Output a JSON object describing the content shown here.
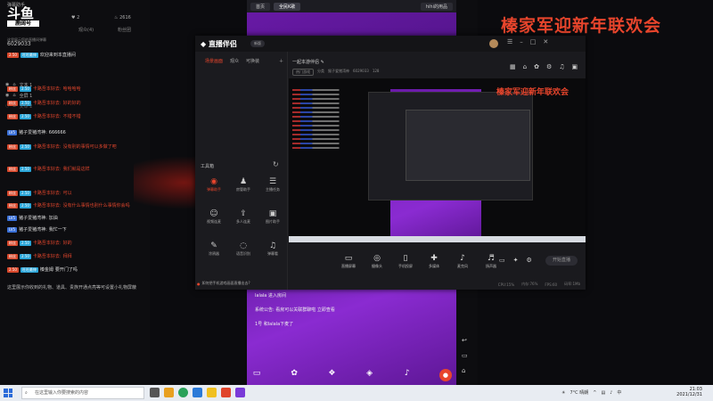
{
  "chat": {
    "logo_main": "斗鱼",
    "logo_sub": "鹿阔号",
    "title": "弹幕助手",
    "stat_fans": "2",
    "stat_hot": "2616",
    "tabs": [
      "观众(4)",
      "粉丝团"
    ],
    "room_id": "6029033",
    "notice_line": "这里展示您的直播间弹幕",
    "messages": [
      {
        "badges": [
          "2.50",
          "旺旺最伸"
        ],
        "user": "",
        "text": "欢迎来到本直播间",
        "color": "white"
      },
      {
        "badges": [
          "粉丝",
          "2.50"
        ],
        "user": "卡路吾本好去:",
        "text": "哈哈哈哈",
        "color": "red"
      },
      {
        "badges": [
          "粉丝",
          "2.50"
        ],
        "user": "卡路吾本好去:",
        "text": "好的好的",
        "color": "red"
      },
      {
        "badges": [
          "粉丝",
          "2.50"
        ],
        "user": "卡路吾本好去:",
        "text": "不错不错",
        "color": "red"
      },
      {
        "badges": [
          "LV5"
        ],
        "user": "猪子爱猪湾神:",
        "text": "666666",
        "color": "white"
      },
      {
        "badges": [
          "粉丝",
          "2.50"
        ],
        "user": "卡路吾本好去:",
        "text": "没有别的事情可以多做了吧",
        "color": "red"
      },
      {
        "badges": [
          "粉丝",
          "2.50"
        ],
        "user": "卡路吾本好去:",
        "text": "我们就是这样",
        "color": "red"
      },
      {
        "badges": [
          "粉丝",
          "2.50"
        ],
        "user": "卡路吾本好去:",
        "text": "可以",
        "color": "red"
      },
      {
        "badges": [
          "粉丝",
          "2.50"
        ],
        "user": "卡路吾本好去:",
        "text": "没有什么事情也别什么事情你会吗",
        "color": "red"
      },
      {
        "badges": [
          "LV5"
        ],
        "user": "猪子爱猪湾神:",
        "text": "加油",
        "color": "white"
      },
      {
        "badges": [
          "LV5"
        ],
        "user": "猪子爱猪湾神:",
        "text": "我忙一下",
        "color": "white"
      },
      {
        "badges": [
          "粉丝",
          "2.50"
        ],
        "user": "卡路吾本好去:",
        "text": "好的",
        "color": "red"
      },
      {
        "badges": [
          "粉丝",
          "2.50"
        ],
        "user": "卡路吾本好去:",
        "text": "拜拜",
        "color": "red"
      },
      {
        "badges": [
          "2.50",
          "旺旺最伸"
        ],
        "user": "榛金姆",
        "text": "要开门了吗",
        "color": "white"
      }
    ],
    "footer_note": "这里展示你收到的礼物、道具、贵族开通点亮等可设置小礼物屏蔽"
  },
  "phone": {
    "tabs": [
      "首页",
      "全民K歌",
      "hihi的用品"
    ],
    "overlay": [
      "lalala 进入房间",
      "系统公告: 看房可以关联群聊啦 立即查看",
      "1号 和lalala下麦了"
    ]
  },
  "banner": {
    "title": "榛家军迎新年联欢会"
  },
  "app": {
    "brand": "直播伴侣",
    "version": "新版",
    "sidebar_tabs": [
      "场景画面",
      "观众",
      "可换装"
    ],
    "scenes": [
      "文本 1",
      "全屏 1",
      "文本 2"
    ],
    "tools_title": "工具箱",
    "tools": [
      {
        "icon": "◉",
        "label": "弹幕助手",
        "on": true
      },
      {
        "icon": "♟",
        "label": "房管助手",
        "on": false
      },
      {
        "icon": "☰",
        "label": "主播任务",
        "on": false
      },
      {
        "icon": "☺",
        "label": "视频连麦",
        "on": false
      },
      {
        "icon": "⇪",
        "label": "多人连麦",
        "on": false
      },
      {
        "icon": "▣",
        "label": "图片助手",
        "on": false
      },
      {
        "icon": "✎",
        "label": "涂鸦器",
        "on": false
      },
      {
        "icon": "◌",
        "label": "语音识别",
        "on": false
      },
      {
        "icon": "♫",
        "label": "弹幕看",
        "on": false
      }
    ],
    "tip": "如何把手机游戏画面直播出去?",
    "main_title": "一起本游伴侣",
    "main_sub": [
      "热门游戏",
      "分类",
      "猴子爱猪湾神",
      "6029033",
      "128"
    ],
    "controls": [
      {
        "icon": "▭",
        "label": "直播屏幕"
      },
      {
        "icon": "◎",
        "label": "摄像头"
      },
      {
        "icon": "▯",
        "label": "手机投屏"
      },
      {
        "icon": "✚",
        "label": "多媒体"
      },
      {
        "icon": "♪",
        "label": "麦克风"
      },
      {
        "icon": "♬",
        "label": "扬声器"
      }
    ],
    "start_label": "开始直播",
    "status": [
      "CPU:15%",
      "内存:76%",
      "FPS:60",
      "码率:1Mb"
    ]
  },
  "taskbar": {
    "search_placeholder": "在这里输入你要搜索的内容",
    "weather": "7°C 晴朗",
    "lang": "中",
    "time": "21:03",
    "date": "2021/12/31"
  }
}
